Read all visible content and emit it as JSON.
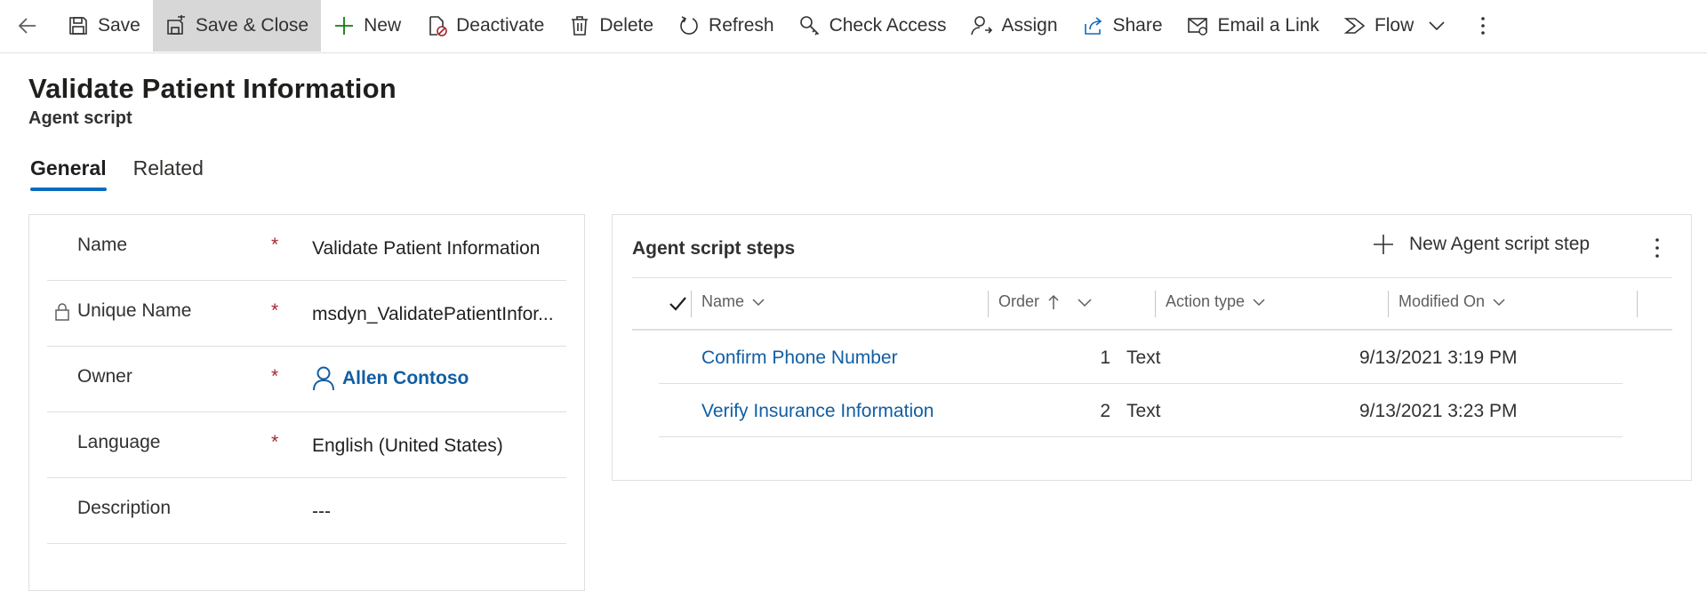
{
  "toolbar": {
    "save": "Save",
    "save_close": "Save & Close",
    "new": "New",
    "deactivate": "Deactivate",
    "delete": "Delete",
    "refresh": "Refresh",
    "check_access": "Check Access",
    "assign": "Assign",
    "share": "Share",
    "email_link": "Email a Link",
    "flow": "Flow"
  },
  "header": {
    "title": "Validate Patient Information",
    "subtitle": "Agent script"
  },
  "tabs": [
    {
      "label": "General",
      "selected": true
    },
    {
      "label": "Related",
      "selected": false
    }
  ],
  "form": {
    "fields": [
      {
        "label": "Name",
        "required": "*",
        "value": "Validate Patient Information"
      },
      {
        "label": "Unique Name",
        "required": "*",
        "value": "msdyn_ValidatePatientInfor..."
      },
      {
        "label": "Owner",
        "required": "*",
        "value": "Allen Contoso"
      },
      {
        "label": "Language",
        "required": "*",
        "value": "English (United States)"
      },
      {
        "label": "Description",
        "value": "---"
      }
    ]
  },
  "subgrid": {
    "title": "Agent script steps",
    "new_label": "New Agent script step",
    "columns": [
      "Name",
      "Order",
      "Action type",
      "Modified On"
    ],
    "rows": [
      {
        "name": "Confirm Phone Number",
        "order": "1",
        "action_type": "Text",
        "modified_on": "9/13/2021 3:19 PM"
      },
      {
        "name": "Verify Insurance Information",
        "order": "2",
        "action_type": "Text",
        "modified_on": "9/13/2021 3:23 PM"
      }
    ]
  },
  "colors": {
    "accent": "#0f6cbd",
    "link": "#115ea3",
    "required": "#a4262c",
    "active_command_bg": "#d7d7d7"
  }
}
